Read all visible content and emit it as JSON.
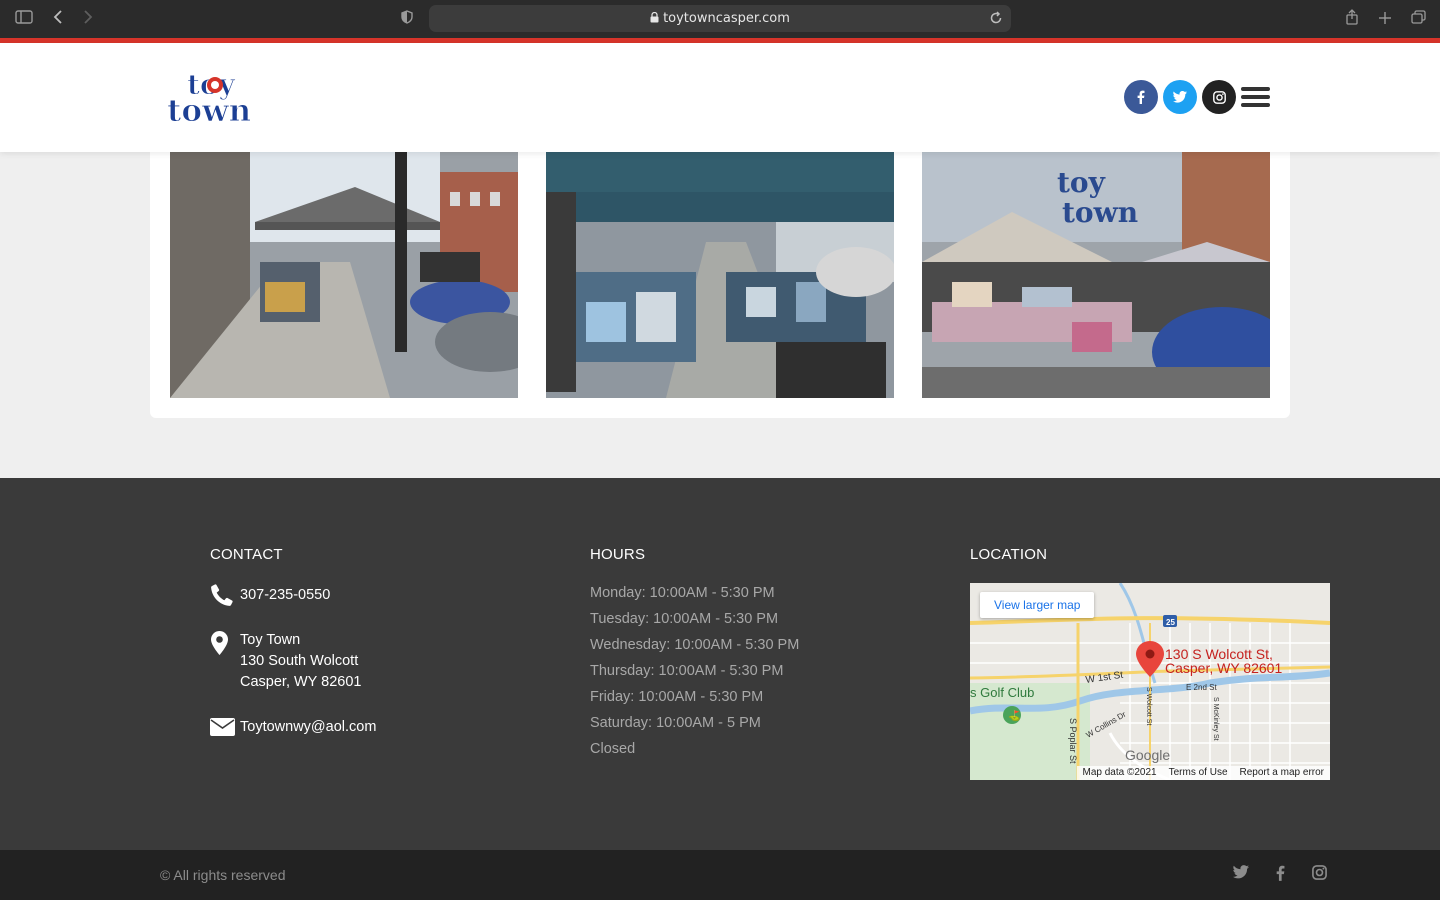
{
  "browser": {
    "url": "toytowncasper.com"
  },
  "header": {
    "logo_text_top": "toy",
    "logo_text_bottom": "town",
    "social": [
      {
        "name": "facebook",
        "glyph": "f",
        "color": "#3b5998"
      },
      {
        "name": "twitter",
        "glyph": "t",
        "color": "#1da1f2"
      },
      {
        "name": "instagram",
        "glyph": "◎",
        "color": "#222222"
      }
    ]
  },
  "footer": {
    "contact": {
      "title": "CONTACT",
      "phone": "307-235-0550",
      "address_name": "Toy Town",
      "address_street": "130 South Wolcott",
      "address_city": "Casper, WY 82601",
      "email": "Toytownwy@aol.com"
    },
    "hours": {
      "title": "HOURS",
      "lines": [
        "Monday: 10:00AM - 5:30 PM",
        "Tuesday: 10:00AM - 5:30 PM",
        "Wednesday: 10:00AM - 5:30 PM",
        "Thursday: 10:00AM - 5:30 PM",
        "Friday: 10:00AM - 5:30 PM",
        "Saturday: 10:00AM - 5 PM",
        "Closed"
      ]
    },
    "location": {
      "title": "LOCATION",
      "view_larger": "View larger map",
      "pin_label_1": "130 S Wolcott St,",
      "pin_label_2": "Casper, WY 82601",
      "street_1st": "W 1st St",
      "street_2nd": "E 2nd St",
      "golf": "s Golf Club",
      "poplar": "S Poplar St",
      "wolcott": "S Wolcott St",
      "mckinley": "S McKinley St",
      "collins": "W Collins Dr",
      "interstate": "25",
      "google": "Google",
      "map_data": "Map data ©2021",
      "terms": "Terms of Use",
      "report": "Report a map error"
    },
    "copyright": "© All rights reserved"
  }
}
